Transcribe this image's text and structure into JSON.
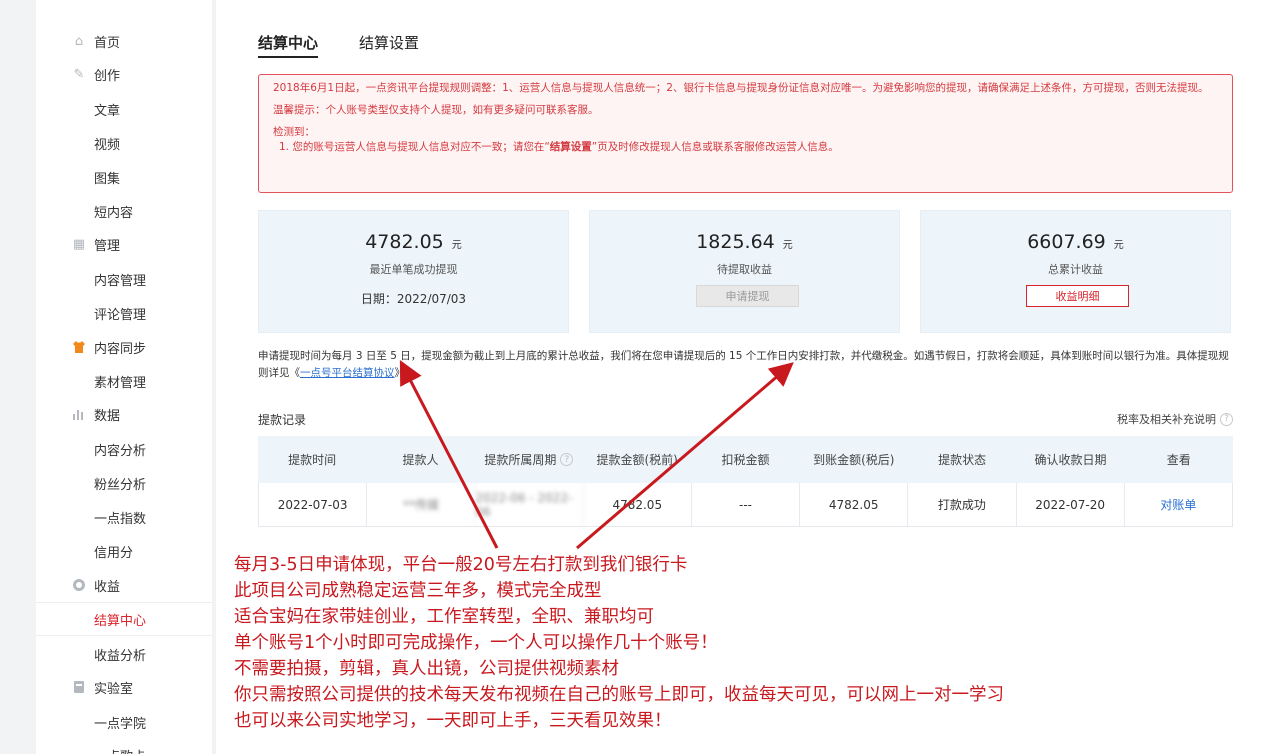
{
  "sidebar": {
    "items": [
      {
        "label": "首页",
        "icon": "home-icon",
        "type": "group"
      },
      {
        "label": "创作",
        "icon": "pen-icon",
        "type": "group"
      },
      {
        "label": "文章",
        "type": "sub"
      },
      {
        "label": "视频",
        "type": "sub"
      },
      {
        "label": "图集",
        "type": "sub"
      },
      {
        "label": "短内容",
        "type": "sub"
      },
      {
        "label": "管理",
        "icon": "grid-icon",
        "type": "group"
      },
      {
        "label": "内容管理",
        "type": "sub"
      },
      {
        "label": "评论管理",
        "type": "sub"
      },
      {
        "label": "内容同步",
        "icon": "shirt-icon",
        "type": "group"
      },
      {
        "label": "素材管理",
        "type": "sub"
      },
      {
        "label": "数据",
        "icon": "bar-chart-icon",
        "type": "group"
      },
      {
        "label": "内容分析",
        "type": "sub"
      },
      {
        "label": "粉丝分析",
        "type": "sub"
      },
      {
        "label": "一点指数",
        "type": "sub"
      },
      {
        "label": "信用分",
        "type": "sub"
      },
      {
        "label": "收益",
        "icon": "coin-icon",
        "type": "group"
      },
      {
        "label": "结算中心",
        "type": "sub",
        "active": true
      },
      {
        "label": "收益分析",
        "type": "sub"
      },
      {
        "label": "实验室",
        "icon": "lab-icon",
        "type": "group"
      },
      {
        "label": "一点学院",
        "type": "sub"
      },
      {
        "label": "一点歌卡",
        "type": "sub"
      }
    ]
  },
  "tabs": {
    "settlement": "结算中心",
    "settings": "结算设置"
  },
  "notice": {
    "line1": "2018年6月1日起，一点资讯平台提现规则调整：1、运营人信息与提现人信息统一；2、银行卡信息与提现身份证信息对应唯一。为避免影响您的提现，请确保满足上述条件，方可提现，否则无法提现。",
    "line2": "温馨提示：个人账号类型仅支持个人提现，如有更多疑问可联系客服。",
    "line3": "检测到：",
    "line4_pre": "1. 您的账号运营人信息与提现人信息对应不一致；请您在“",
    "line4_bold": "结算设置",
    "line4_post": "”页及时修改提现人信息或联系客服修改运营人信息。"
  },
  "cards": {
    "last": {
      "amount": "4782.05",
      "unit": "元",
      "label": "最近单笔成功提现",
      "date": "日期：2022/07/03"
    },
    "pending": {
      "amount": "1825.64",
      "unit": "元",
      "label": "待提取收益",
      "button": "申请提现"
    },
    "total": {
      "amount": "6607.69",
      "unit": "元",
      "label": "总累计收益",
      "button": "收益明细"
    }
  },
  "info": {
    "text": "申请提现时间为每月 3 日至 5 日，提现金额为截止到上月底的累计总收益，我们将在您申请提现后的 15 个工作日内安排打款，并代缴税金。如遇节假日，打款将会顺延，具体到账时间以银行为准。具体提现规则详见《一点号平台结算协议》",
    "link": "一点号平台结算协议",
    "pre": "申请提现时间为每月 3 日至 5 日，提现金额为截止到上月底的累计总收益，我们将在您申请提现后的 15 个工作日内安排打款，并代缴税金。如遇节假日，打款将会顺延，具体到账时间以银行为准。具体提现规则详见《",
    "post": "。"
  },
  "records": {
    "title": "提款记录",
    "note": "税率及相关补充说明",
    "headers": [
      "提款时间",
      "提款人",
      "提款所属周期",
      "提款金额(税前)",
      "扣税金额",
      "到账金额(税后)",
      "提款状态",
      "确认收款日期",
      "查看"
    ],
    "rows": [
      [
        "2022-07-03",
        "**传媒",
        "2022-06 - 2022-06",
        "4782.05",
        "---",
        "4782.05",
        "打款成功",
        "2022-07-20",
        "对账单"
      ]
    ]
  },
  "overlay": {
    "lines": [
      "每月3-5日申请体现，平台一般20号左右打款到我们银行卡",
      "此项目公司成熟稳定运营三年多，模式完全成型",
      "适合宝妈在家带娃创业，工作室转型，全职、兼职均可",
      "单个账号1个小时即可完成操作，一个人可以操作几十个账号！",
      "不需要拍摄，剪辑，真人出镜，公司提供视频素材",
      "你只需按照公司提供的技术每天发布视频在自己的账号上即可，收益每天可见，可以网上一对一学习",
      "也可以来公司实地学习，一天即可上手，三天看见效果！"
    ]
  },
  "colors": {
    "accent": "#d9242c",
    "annotation": "#c8191f",
    "link": "#2a6fd0",
    "card_bg": "#eef5fa"
  }
}
